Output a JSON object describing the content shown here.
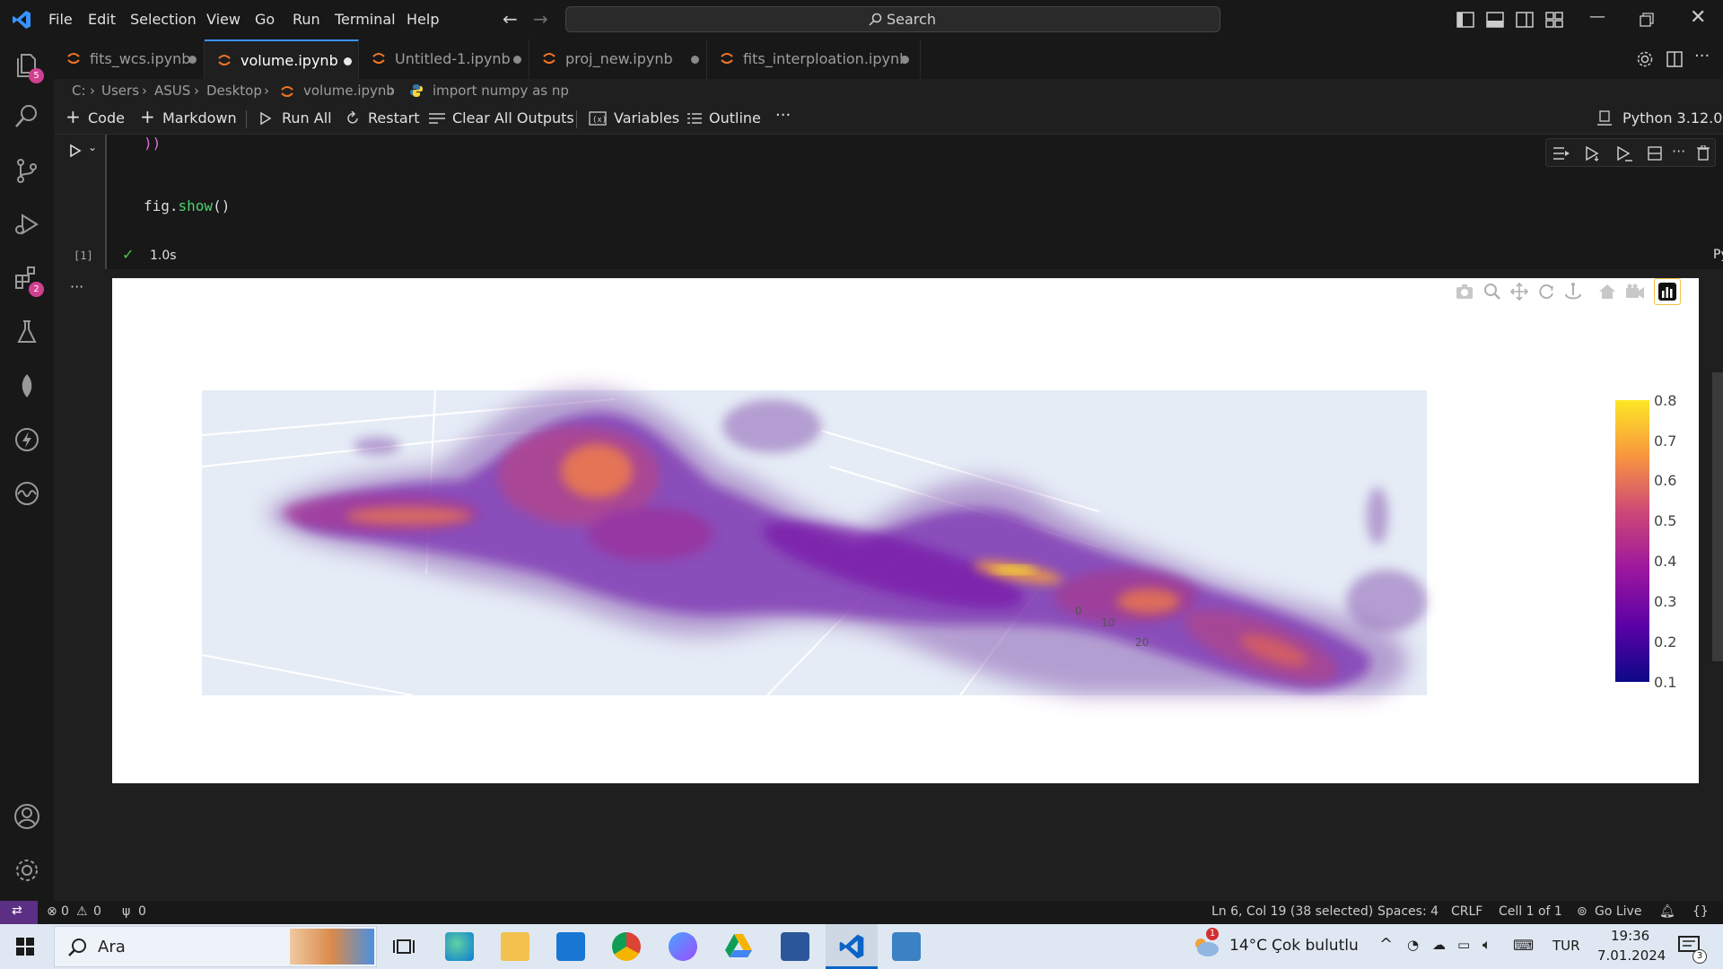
{
  "menu": [
    "File",
    "Edit",
    "Selection",
    "View",
    "Go",
    "Run",
    "Terminal",
    "Help"
  ],
  "search": {
    "label": "Search"
  },
  "activity_badges": {
    "explorer": "5",
    "extensions": "2"
  },
  "tabs": [
    {
      "label": "fits_wcs.ipynb",
      "active": false
    },
    {
      "label": "volume.ipynb",
      "active": true
    },
    {
      "label": "Untitled-1.ipynb",
      "active": false
    },
    {
      "label": "proj_new.ipynb",
      "active": false
    },
    {
      "label": "fits_interploation.ipynb",
      "active": false
    }
  ],
  "breadcrumb": [
    "C:",
    "Users",
    "ASUS",
    "Desktop",
    "volume.ipynb",
    "import numpy as np"
  ],
  "toolbar": {
    "code": "Code",
    "markdown": "Markdown",
    "run_all": "Run All",
    "restart": "Restart",
    "clear_outputs": "Clear All Outputs",
    "variables": "Variables",
    "outline": "Outline",
    "more": "···",
    "kernel": "Python 3.12.0"
  },
  "cell": {
    "code_line1": "))",
    "code_line2_obj": "fig.",
    "code_line2_fn": "show",
    "code_line2_tail": "()",
    "exec_count": "[1]",
    "duration": "1.0s",
    "language": "Python",
    "output_more": "···"
  },
  "colorbar": {
    "ticks": [
      "0.8",
      "0.7",
      "0.6",
      "0.5",
      "0.4",
      "0.3",
      "0.2",
      "0.1"
    ],
    "colors": [
      "#fde725",
      "#f89540",
      "#cc4778",
      "#9c179e",
      "#5c01a6",
      "#0d0887"
    ]
  },
  "plot_axis_labels": [
    "0",
    "10",
    "20"
  ],
  "status": {
    "errors": "0",
    "warnings": "0",
    "ports": "0",
    "position": "Ln 6, Col 19 (38 selected)",
    "spaces": "Spaces: 4",
    "eol": "CRLF",
    "cell": "Cell 1 of 1",
    "golive": "Go Live"
  },
  "taskbar": {
    "search": "Ara",
    "weather_temp": "14°C",
    "weather_desc": "Çok bulutlu",
    "weather_badge": "1",
    "lang": "TUR",
    "time": "19:36",
    "date": "7.01.2024",
    "notif": "3"
  }
}
